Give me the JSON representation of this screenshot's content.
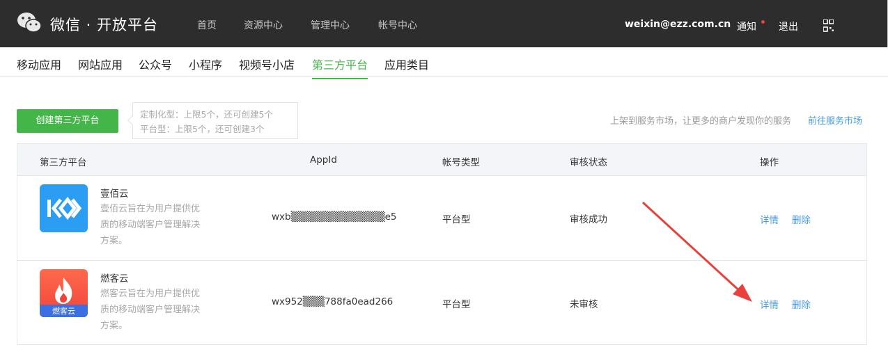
{
  "header": {
    "brand": "微信 · 开放平台",
    "nav": [
      "首页",
      "资源中心",
      "管理中心",
      "帐号中心"
    ],
    "user": "weixin@ezz.com.cn",
    "notice": "通知",
    "logout": "退出",
    "icons": {
      "logo": "wechat-logo-icon",
      "qr": "qr-code-icon"
    }
  },
  "subnav": {
    "tabs": [
      "移动应用",
      "网站应用",
      "公众号",
      "小程序",
      "视频号小店",
      "第三方平台",
      "应用类目"
    ],
    "active": "第三方平台"
  },
  "create": {
    "button": "创建第三方平台",
    "limit_custom": "定制化型：上限5个，还可创建5个",
    "limit_platform": "平台型：上限5个，还可创建3个"
  },
  "market": {
    "text": "上架到服务市场，让更多的商户发现你的服务",
    "link": "前往服务市场"
  },
  "table": {
    "headers": [
      "第三方平台",
      "AppId",
      "帐号类型",
      "审核状态",
      "操作"
    ],
    "rows": [
      {
        "name": "壹佰云",
        "desc": "壹佰云旨在为用户提供优质的移动端客户管理解决方案。",
        "appid": "wxb▒▒▒▒▒▒▒▒▒▒▒▒▒e5",
        "type": "平台型",
        "status": "审核成功",
        "detail": "详情",
        "delete": "删除"
      },
      {
        "name": "燃客云",
        "desc": "燃客云旨在为用户提供优质的移动端客户管理解决方案。",
        "appid": "wx952▒▒▒788fa0ead266",
        "icon_label": "燃客云",
        "type": "平台型",
        "status": "未审核",
        "detail": "详情",
        "delete": "删除"
      }
    ]
  },
  "colors": {
    "accent": "#44b549",
    "link": "#459ae9",
    "topbar": "#2d2d2d",
    "arrow": "#e8413b"
  }
}
